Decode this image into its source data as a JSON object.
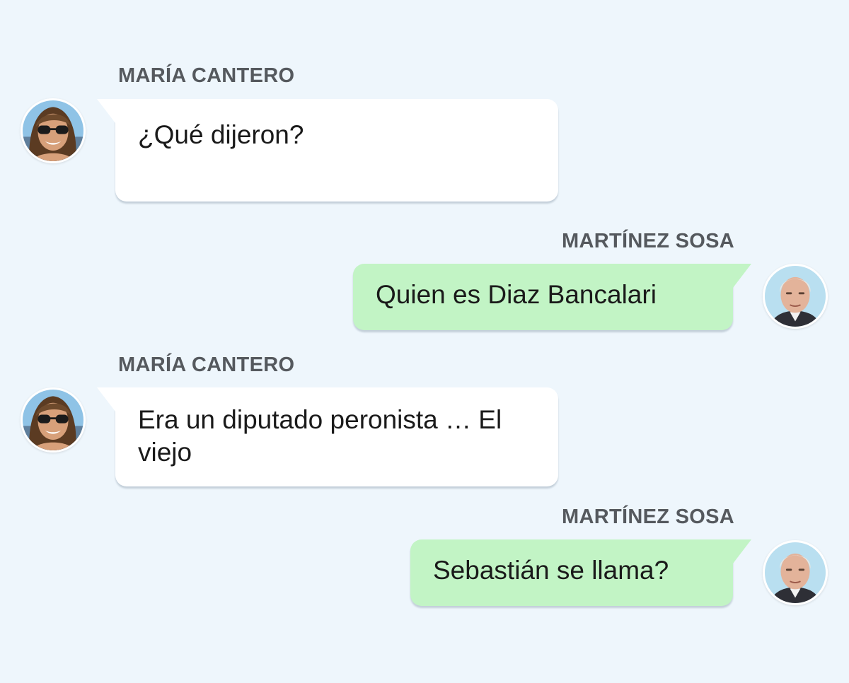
{
  "colors": {
    "background": "#eef6fc",
    "incoming_bubble": "#ffffff",
    "outgoing_bubble": "#c2f4c5",
    "sender_name": "#55595e"
  },
  "messages": [
    {
      "sender": "MARÍA CANTERO",
      "avatar_icon": "woman-sunglasses-avatar",
      "direction": "incoming",
      "text": "¿Qué dijeron?"
    },
    {
      "sender": "MARTÍNEZ SOSA",
      "avatar_icon": "older-man-avatar",
      "direction": "outgoing",
      "text": "Quien es Diaz Bancalari"
    },
    {
      "sender": "MARÍA CANTERO",
      "avatar_icon": "woman-sunglasses-avatar",
      "direction": "incoming",
      "text": "Era un diputado peronista … El viejo"
    },
    {
      "sender": "MARTÍNEZ SOSA",
      "avatar_icon": "older-man-avatar",
      "direction": "outgoing",
      "text": "Sebastián se llama?"
    }
  ]
}
